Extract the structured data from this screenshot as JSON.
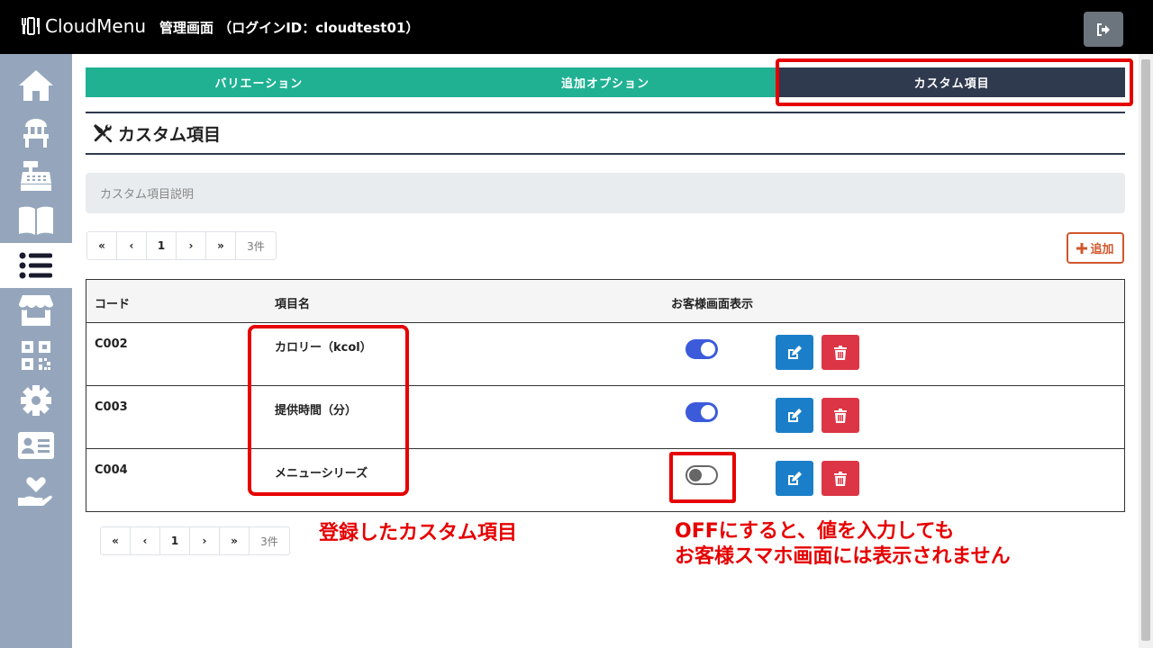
{
  "header": {
    "logo_text": "CloudMenu",
    "title": "管理画面 （ログインID：cloudtest01）"
  },
  "sidebar": {
    "items": [
      {
        "icon": "home-icon",
        "active": false
      },
      {
        "icon": "chair-icon",
        "active": false
      },
      {
        "icon": "cash-register-icon",
        "active": false
      },
      {
        "icon": "book-icon",
        "active": false
      },
      {
        "icon": "list-icon",
        "active": true
      },
      {
        "icon": "store-icon",
        "active": false
      },
      {
        "icon": "qrcode-icon",
        "active": false
      },
      {
        "icon": "gear-icon",
        "active": false
      },
      {
        "icon": "id-card-icon",
        "active": false
      },
      {
        "icon": "hand-heart-icon",
        "active": false
      }
    ]
  },
  "tabs": [
    {
      "label": "バリエーション",
      "active": false
    },
    {
      "label": "追加オプション",
      "active": false
    },
    {
      "label": "カスタム項目",
      "active": true
    }
  ],
  "section": {
    "title": "カスタム項目"
  },
  "description": {
    "placeholder": "カスタム項目説明"
  },
  "pager": {
    "first": "«",
    "prev": "‹",
    "page": "1",
    "next": "›",
    "last": "»",
    "count": "3件"
  },
  "add_button": {
    "label": "追加"
  },
  "table": {
    "headers": {
      "code": "コード",
      "name": "項目名",
      "display": "お客様画面表示"
    },
    "rows": [
      {
        "code": "C002",
        "name": "カロリー（kcol）",
        "display_on": true
      },
      {
        "code": "C003",
        "name": "提供時間（分）",
        "display_on": true
      },
      {
        "code": "C004",
        "name": "メニューシリーズ",
        "display_on": false
      }
    ]
  },
  "annotations": {
    "registered": "登録したカスタム項目",
    "off_note_line1": "OFFにすると、値を入力しても",
    "off_note_line2": "お客様スマホ画面には表示されません"
  },
  "colors": {
    "tab_green": "#1fb192",
    "tab_active": "#2f3a4f",
    "sidebar": "#95a6bc",
    "toggle_on": "#3b5bdb",
    "edit_blue": "#1a7fc8",
    "delete_red": "#dc3545",
    "highlight_red": "#e60000",
    "add_orange": "#d0572d"
  }
}
